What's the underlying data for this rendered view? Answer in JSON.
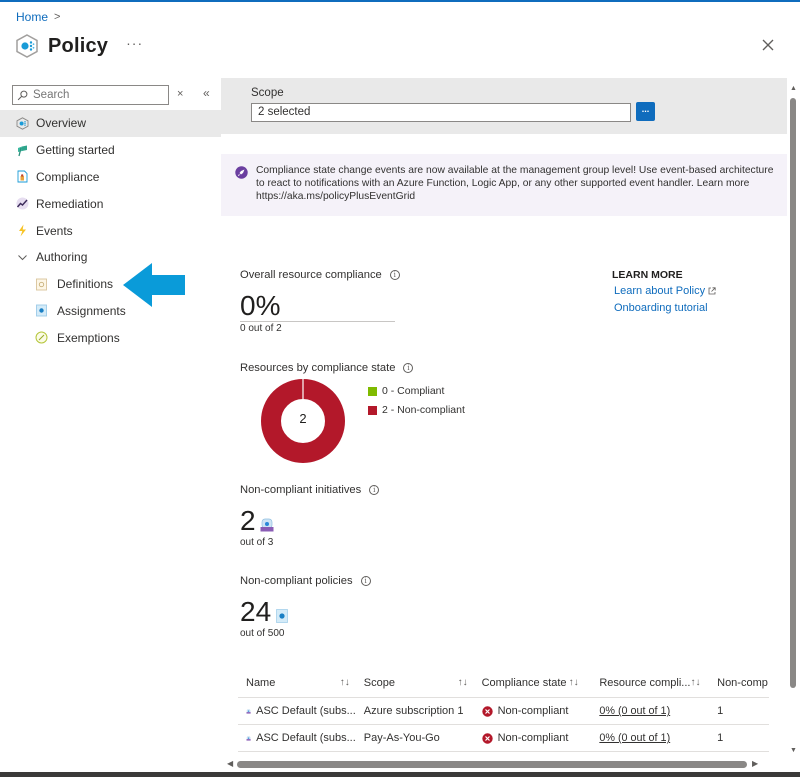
{
  "breadcrumb": {
    "home": "Home",
    "separator": ">"
  },
  "header": {
    "title": "Policy",
    "more": "···",
    "close": "close"
  },
  "sidebar": {
    "search_placeholder": "Search",
    "clear": "×",
    "collapse": "«",
    "items": [
      {
        "label": "Overview",
        "icon": "policy-overview-icon",
        "active": true
      },
      {
        "label": "Getting started",
        "icon": "flag-icon"
      },
      {
        "label": "Compliance",
        "icon": "compliance-doc-icon"
      },
      {
        "label": "Remediation",
        "icon": "remediation-chart-icon"
      },
      {
        "label": "Events",
        "icon": "lightning-icon"
      },
      {
        "label": "Authoring",
        "icon": "chevron-down-icon",
        "expandable": true,
        "expanded": true
      },
      {
        "label": "Definitions",
        "icon": "definitions-icon",
        "child": true
      },
      {
        "label": "Assignments",
        "icon": "assignments-icon",
        "child": true
      },
      {
        "label": "Exemptions",
        "icon": "exemptions-icon",
        "child": true
      }
    ]
  },
  "annotation": {
    "arrow_color": "#0a9bd9",
    "points_to": "Definitions"
  },
  "scope": {
    "label": "Scope",
    "value": "2 selected",
    "button": "..."
  },
  "banner": {
    "text": "Compliance state change events are now available at the management group level! Use event-based architecture to react to notifications with an Azure Function, Logic App, or any other supported event handler. Learn more https://aka.ms/policyPlusEventGrid"
  },
  "overall": {
    "label": "Overall resource compliance",
    "value": "0%",
    "sub": "0 out of 2"
  },
  "learn_more": {
    "title": "LEARN MORE",
    "links": [
      "Learn about Policy",
      "Onboarding tutorial"
    ]
  },
  "by_state": {
    "label": "Resources by compliance state",
    "center": "2",
    "legend": [
      {
        "label": "0 - Compliant",
        "count": 0,
        "color": "#7fba00"
      },
      {
        "label": "2 - Non-compliant",
        "count": 2,
        "color": "#b3182a"
      }
    ]
  },
  "initiatives": {
    "label": "Non-compliant initiatives",
    "value": "2",
    "sub": "out of 3"
  },
  "policies": {
    "label": "Non-compliant policies",
    "value": "24",
    "sub": "out of 500"
  },
  "table": {
    "columns": [
      "Name",
      "Scope",
      "Compliance state",
      "Resource compli...",
      "Non-comp"
    ],
    "sort_glyph": "↑↓",
    "rows": [
      {
        "name": "ASC Default (subs...",
        "scope": "Azure subscription 1",
        "state": "Non-compliant",
        "resource": "0% (0 out of 1)",
        "noncomp": "1"
      },
      {
        "name": "ASC Default (subs...",
        "scope": "Pay-As-You-Go",
        "state": "Non-compliant",
        "resource": "0% (0 out of 1)",
        "noncomp": "1"
      }
    ]
  },
  "colors": {
    "accent": "#0f6cbd",
    "noncompliant": "#b3182a",
    "compliant": "#7fba00",
    "banner_bg": "#f5f2f9"
  }
}
